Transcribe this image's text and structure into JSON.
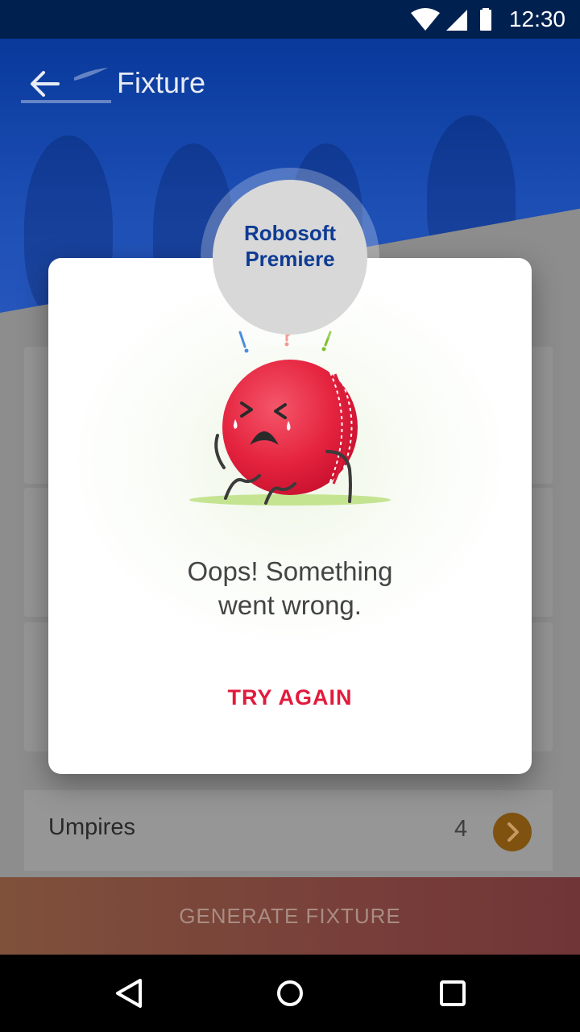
{
  "status_bar": {
    "time": "12:30"
  },
  "header": {
    "title": "Fixture"
  },
  "league": {
    "name": "Robosoft Premiere"
  },
  "umpires": {
    "label": "Umpires",
    "count": "4"
  },
  "footer": {
    "generate_label": "GENERATE FIXTURE"
  },
  "dialog": {
    "message_line1": "Oops! Something",
    "message_line2": "went wrong.",
    "action_label": "TRY AGAIN"
  },
  "colors": {
    "accent": "#e21a3c",
    "ball": "#e5243f",
    "header_blue": "#0a3ea8"
  },
  "icons": {
    "back": "arrow-left-icon",
    "wifi": "wifi-icon",
    "signal": "signal-icon",
    "battery": "battery-icon",
    "chevron": "chevron-right-icon",
    "nav_back": "triangle-back-icon",
    "nav_home": "circle-home-icon",
    "nav_recents": "square-recents-icon"
  }
}
